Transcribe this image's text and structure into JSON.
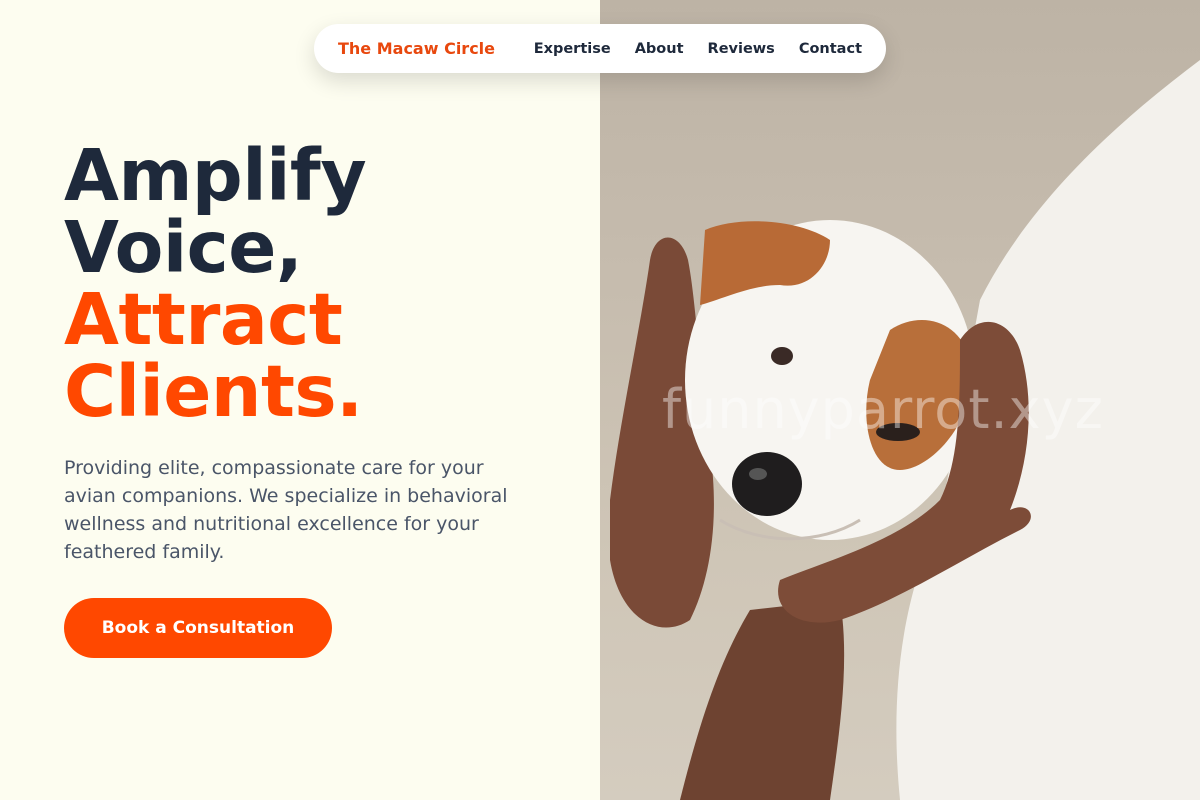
{
  "nav": {
    "brand": "The Macaw Circle",
    "links": [
      "Expertise",
      "About",
      "Reviews",
      "Contact"
    ]
  },
  "hero": {
    "headline_line1": "Amplify",
    "headline_line2": "Voice,",
    "headline_accent_line1": "Attract",
    "headline_accent_line2": "Clients.",
    "description": "Providing elite, compassionate care for your avian companions. We specialize in behavioral wellness and nutritional excellence for your feathered family.",
    "cta_label": "Book a Consultation"
  },
  "image": {
    "alt": "",
    "watermark": "funnyparrot.xyz"
  },
  "colors": {
    "accent": "#ff4800",
    "brand": "#e8480e",
    "heading": "#1e293b",
    "body_text": "#4a5568",
    "background": "#fdfdf0"
  }
}
